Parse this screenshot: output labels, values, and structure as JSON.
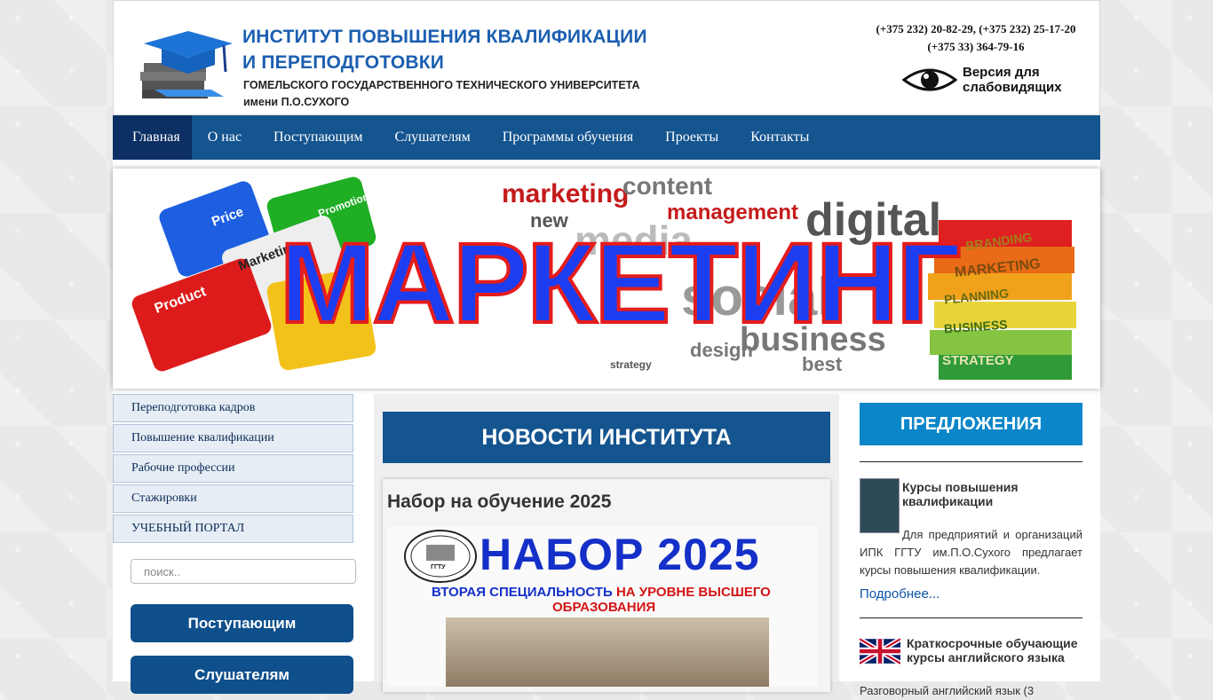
{
  "header": {
    "title_line1": "ИНСТИТУТ ПОВЫШЕНИЯ КВАЛИФИКАЦИИ",
    "title_line2": "И ПЕРЕПОДГОТОВКИ",
    "subtitle_line1": "ГОМЕЛЬСКОГО ГОСУДАРСТВЕННОГО ТЕХНИЧЕСКОГО УНИВЕРСИТЕТА",
    "subtitle_line2": "имени П.О.СУХОГО",
    "phones_line1": "(+375 232) 20-82-29, (+375 232) 25-17-20",
    "phones_line2": "(+375 33) 364-79-16",
    "vision_line1": "Версия для",
    "vision_line2": "слабовидящих"
  },
  "nav": {
    "items": [
      "Главная",
      "О нас",
      "Поступающим",
      "Слушателям",
      "Программы обучения",
      "Проекты",
      "Контакты"
    ]
  },
  "banner": {
    "title": "МАРКЕТИНГ",
    "puzzle": [
      "Price",
      "Promotion",
      "Marketing",
      "Product"
    ],
    "cloud": [
      "marketing",
      "content",
      "management",
      "media",
      "social",
      "digital",
      "business",
      "design",
      "new",
      "best",
      "strategy"
    ],
    "books": [
      "BRANDING",
      "MARKETING",
      "PLANNING",
      "BUSINESS",
      "STRATEGY"
    ]
  },
  "sidebar": {
    "items": [
      "Переподготовка кадров",
      "Повышение квалификации",
      "Рабочие профессии",
      "Стажировки",
      "УЧЕБНЫЙ ПОРТАЛ"
    ],
    "search_placeholder": "поиск..",
    "btn_applicants": "Поступающим",
    "btn_students": "Слушателям"
  },
  "news": {
    "header": "НОВОСТИ ИНСТИТУТА",
    "item_title": "Набор на обучение 2025",
    "img_logo": "ГГТУ",
    "img_big": "НАБОР 2025",
    "img_line1_a": "ВТОРАЯ СПЕЦИАЛЬНОСТЬ",
    "img_line1_b": "НА УРОВНЕ ВЫСШЕГО",
    "img_line2": "ОБРАЗОВАНИЯ"
  },
  "offers": {
    "header": "ПРЕДЛОЖЕНИЯ",
    "item1_title": "Курсы повышения квалификации",
    "item1_text": "Для предприятий и организаций ИПК ГГТУ им.П.О.Сухого предлагает курсы повышения квалификации.",
    "item1_link": "Подробнее...",
    "item2_title": "Краткосрочные обучающие курсы английского языка",
    "item2_text": "Разговорный английский язык (3"
  }
}
